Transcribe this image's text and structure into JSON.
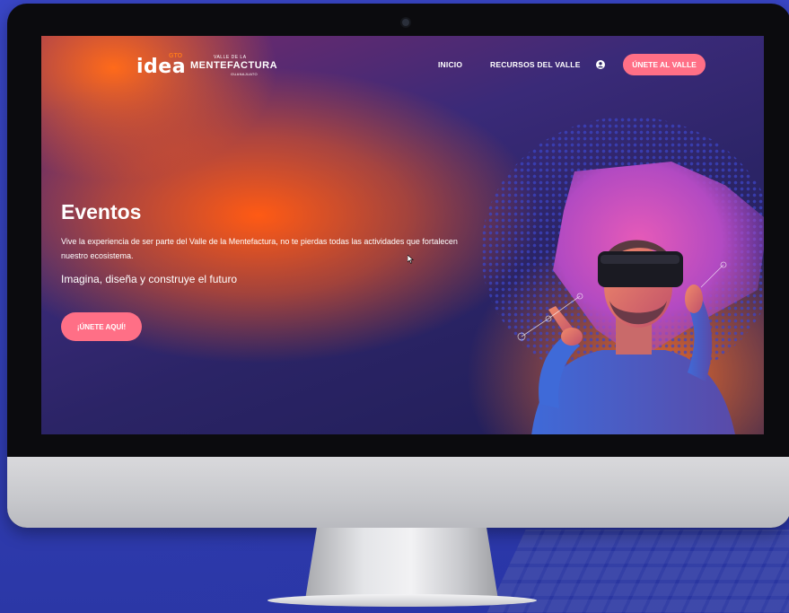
{
  "logo": {
    "idea": "idea",
    "gto": "GTO",
    "valle_de_la": "VALLE DE LA",
    "mentefactura": "MENTEFACTURA",
    "guanajuato": "GUANAJUATO"
  },
  "nav": {
    "items": [
      {
        "label": "INICIO"
      },
      {
        "label": "RECURSOS DEL VALLE"
      }
    ],
    "cta_label": "ÚNETE AL VALLE"
  },
  "hero": {
    "title": "Eventos",
    "description": "Vive la experiencia de ser parte del Valle de la Mentefactura, no te pierdas todas las actividades que fortalecen nuestro ecosistema.",
    "subtitle": "Imagina, diseña y construye el futuro",
    "cta_label": "¡ÚNETE AQUÍ!"
  },
  "colors": {
    "accent_pink": "#ff6f86",
    "brand_orange": "#ff5a14",
    "backdrop_blue": "#3340b8"
  }
}
